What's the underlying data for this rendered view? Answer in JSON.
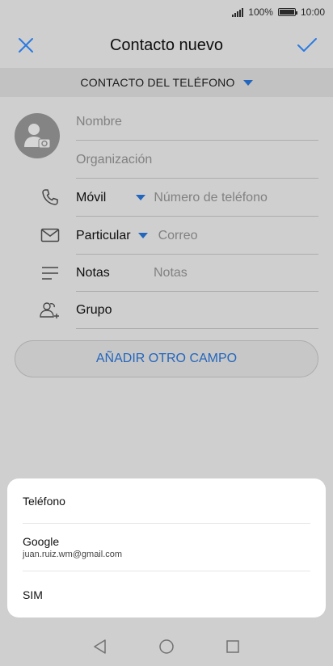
{
  "status_bar": {
    "battery_percent": "100%",
    "time": "10:00"
  },
  "app_bar": {
    "title": "Contacto nuevo"
  },
  "account_selector": {
    "label": "CONTACTO DEL TELÉFONO"
  },
  "form": {
    "name_placeholder": "Nombre",
    "organization_placeholder": "Organización",
    "phone_type": "Móvil",
    "phone_placeholder": "Número de teléfono",
    "email_type": "Particular",
    "email_placeholder": "Correo",
    "notes_label": "Notas",
    "notes_placeholder": "Notas",
    "group_label": "Grupo"
  },
  "add_field_button": {
    "label": "AÑADIR OTRO CAMPO"
  },
  "account_sheet": {
    "options": [
      {
        "title": "Teléfono",
        "subtitle": ""
      },
      {
        "title": "Google",
        "subtitle": "juan.ruiz.wm@gmail.com"
      },
      {
        "title": "SIM",
        "subtitle": ""
      }
    ]
  },
  "colors": {
    "accent": "#2a7ae2",
    "scrim": "rgba(0,0,0,0.16)"
  }
}
